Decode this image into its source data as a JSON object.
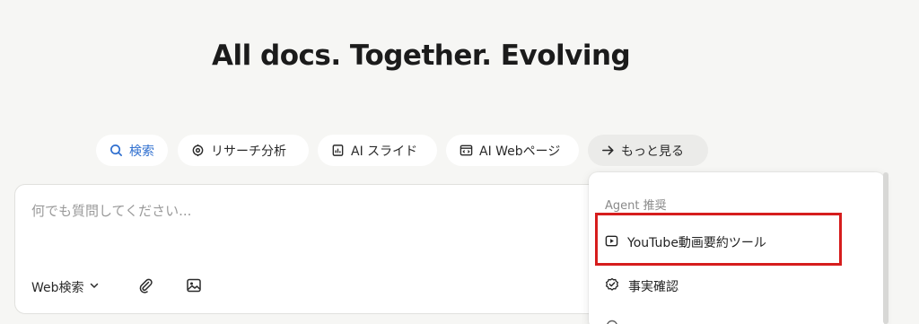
{
  "page": {
    "title": "All docs. Together. Evolving"
  },
  "chips": [
    {
      "label": "検索",
      "icon": "search-icon"
    },
    {
      "label": "リサーチ分析",
      "icon": "research-icon"
    },
    {
      "label": "AI スライド",
      "icon": "slide-icon"
    },
    {
      "label": "AI Webページ",
      "icon": "webpage-icon"
    },
    {
      "label": "もっと見る",
      "icon": "arrow-right-icon"
    }
  ],
  "composer": {
    "placeholder": "何でも質問してください...",
    "web_search_label": "Web検索"
  },
  "dropdown": {
    "section_label": "Agent 推奨",
    "items": [
      {
        "label": "YouTube動画要約ツール",
        "icon": "play-icon"
      },
      {
        "label": "事実確認",
        "icon": "check-badge-icon"
      }
    ]
  },
  "colors": {
    "accent": "#2f6fcf",
    "highlight": "#d61d1d",
    "background": "#f6f6f4"
  }
}
